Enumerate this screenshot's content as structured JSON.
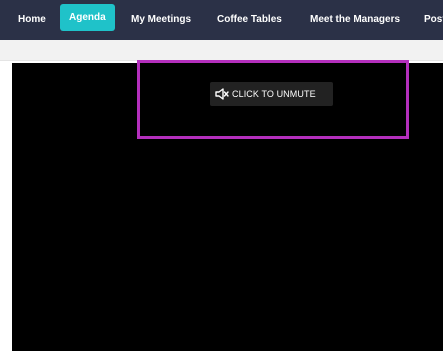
{
  "nav": {
    "items": [
      {
        "label": "Home"
      },
      {
        "label": "Agenda",
        "active": true
      },
      {
        "label": "My Meetings"
      },
      {
        "label": "Coffee Tables"
      },
      {
        "label": "Meet the Managers"
      },
      {
        "label": "Post"
      }
    ]
  },
  "video": {
    "unmute_label": "CLICK TO UNMUTE",
    "unmute_icon": "speaker-muted-icon"
  },
  "colors": {
    "nav_background": "#2b3147",
    "active_tab": "#1fc2c9",
    "video_background": "#000000",
    "highlight_border": "#b42fbd"
  }
}
